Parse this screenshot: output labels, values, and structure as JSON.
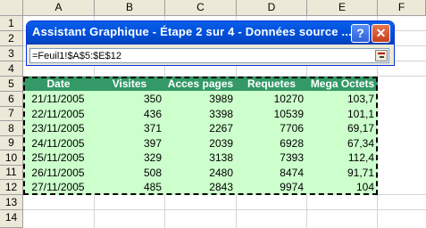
{
  "spreadsheet": {
    "columns": [
      "A",
      "B",
      "C",
      "D",
      "E",
      "F"
    ],
    "rows": [
      "1",
      "2",
      "3",
      "4",
      "5",
      "6",
      "7",
      "8",
      "9",
      "10",
      "11",
      "12",
      "13",
      "14"
    ],
    "headers": [
      "Date",
      "Visites",
      "Acces pages",
      "Requetes",
      "Mega Octets"
    ],
    "data": [
      [
        "21/11/2005",
        "350",
        "3989",
        "10270",
        "103,7"
      ],
      [
        "22/11/2005",
        "436",
        "3398",
        "10539",
        "101,1"
      ],
      [
        "23/11/2005",
        "371",
        "2267",
        "7706",
        "69,17"
      ],
      [
        "24/11/2005",
        "397",
        "2039",
        "6928",
        "67,34"
      ],
      [
        "25/11/2005",
        "329",
        "3138",
        "7393",
        "112,4"
      ],
      [
        "26/11/2005",
        "508",
        "2480",
        "8474",
        "91,71"
      ],
      [
        "27/11/2005",
        "485",
        "2843",
        "9974",
        "104"
      ]
    ],
    "header_bg": "#339966",
    "data_bg": "#ccffcc"
  },
  "dialog": {
    "title": "Assistant Graphique - Étape 2 sur 4 - Données source ...",
    "help_label": "?",
    "close_label": "✕",
    "range_value": "=Feuil1!$A$5:$E$12"
  }
}
